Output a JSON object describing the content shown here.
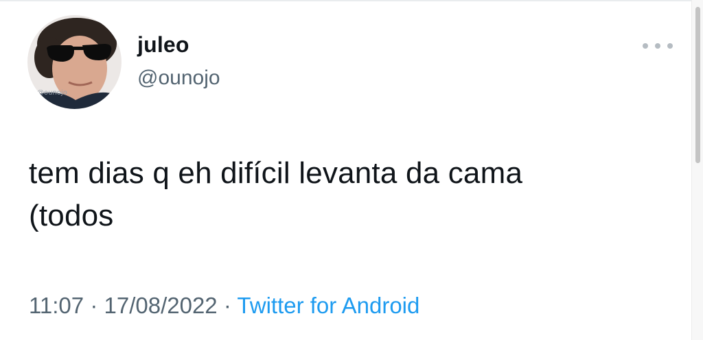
{
  "user": {
    "display_name": "juleo",
    "handle": "@ounojo",
    "avatar_watermark": "@ounojo"
  },
  "tweet": {
    "text": "tem dias q eh difícil levanta da cama\n(todos"
  },
  "meta": {
    "time": "11:07",
    "separator": "·",
    "date": "17/08/2022",
    "source": "Twitter for Android"
  },
  "icons": {
    "more": "more-horizontal-icon"
  },
  "colors": {
    "text": "#0f1419",
    "secondary": "#536471",
    "link": "#1d9bf0"
  }
}
